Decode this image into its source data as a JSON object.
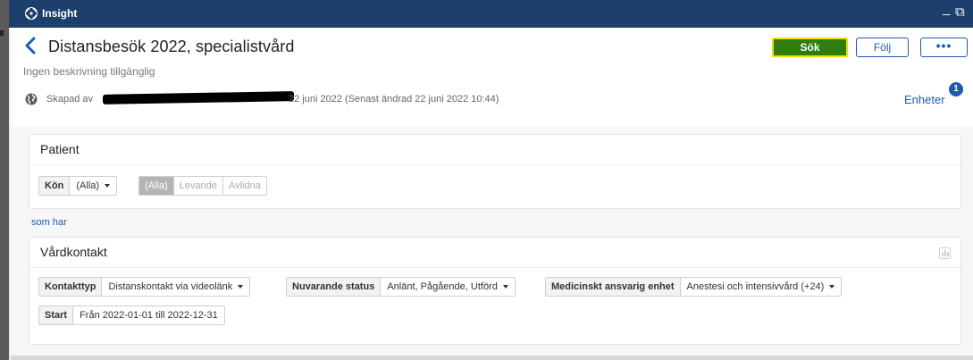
{
  "titlebar": {
    "app_name": "Insight",
    "minimize_glyph": "_",
    "restore_glyph": "⧉",
    "logo_icon": "insight-logo-icon"
  },
  "header": {
    "title": "Distansbesök 2022, specialistvård",
    "subtitle": "Ingen beskrivning tillgänglig",
    "created_prefix": "Skapad av",
    "created_date": "22 juni 2022  (Senast ändrad 22 juni 2022 10:44)",
    "search_label": "Sök",
    "follow_label": "Följ",
    "more_label": "•••",
    "units_label": "Enheter",
    "units_count": "1"
  },
  "patient": {
    "title": "Patient",
    "gender_label": "Kön",
    "gender_value": "(Alla)",
    "status_options": [
      "(Alla)",
      "Levande",
      "Avlidna"
    ],
    "status_selected": "(Alla)"
  },
  "connector": "som har",
  "vardkontakt": {
    "title": "Vårdkontakt",
    "filters": [
      {
        "label": "Kontakttyp",
        "value": "Distanskontakt via videolänk"
      },
      {
        "label": "Nuvarande status",
        "value": "Anlänt, Pågående, Utförd"
      },
      {
        "label": "Medicinskt ansvarig enhet",
        "value": "Anestesi och intensivvård (+24)"
      }
    ],
    "start_label": "Start",
    "start_value": "Från 2022-01-01 till 2022-12-31"
  },
  "colors": {
    "titlebar": "#1c3f6b",
    "accent": "#1d5bab",
    "search_button": "#2e7d0d",
    "search_outline": "#f0e000"
  }
}
